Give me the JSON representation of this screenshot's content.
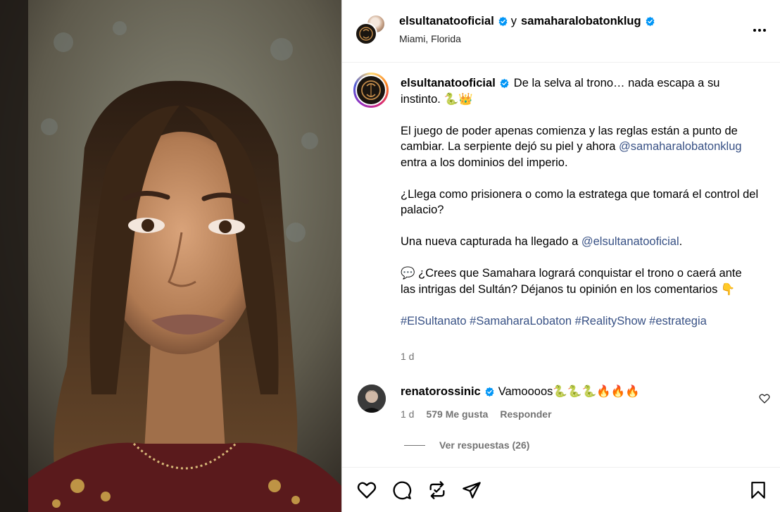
{
  "header": {
    "account1": "elsultanatooficial",
    "conjunction": "y",
    "account2": "samaharalobatonklug",
    "location": "Miami, Florida",
    "more_icon": "more-horizontal-icon"
  },
  "caption": {
    "username": "elsultanatooficial",
    "line1": "De la selva al trono… nada escapa a su instinto. 🐍👑",
    "para2_pre": "El juego de poder apenas comienza y las reglas están a punto de cambiar. La serpiente dejó su piel y ahora ",
    "para2_mention": "@samaharalobatonklug",
    "para2_post": " entra a los dominios del imperio.",
    "para3": "¿Llega como prisionera o como la estratega que tomará el control del palacio?",
    "para4_pre": "Una nueva capturada ha llegado a ",
    "para4_mention": "@elsultanatooficial",
    "para4_post": ".",
    "para5": "💬 ¿Crees que Samahara logrará conquistar el trono o caerá ante las intrigas del Sultán? Déjanos tu opinión en los comentarios 👇",
    "hashtags": "#ElSultanato #SamaharaLobaton #RealityShow #estrategia",
    "time": "1 d"
  },
  "comment": {
    "username": "renatorossinic",
    "text": "Vamoooos🐍🐍🐍🔥🔥🔥",
    "time": "1 d",
    "likes": "579 Me gusta",
    "reply": "Responder",
    "view_replies": "Ver respuestas (26)"
  },
  "icons": {
    "like": "heart-icon",
    "comment": "comment-icon",
    "repost": "repost-icon",
    "share": "share-icon",
    "save": "bookmark-icon",
    "verified": "verified-badge-icon"
  },
  "colors": {
    "link": "#385185",
    "verified": "#0095f6",
    "secondary_text": "#737373"
  }
}
